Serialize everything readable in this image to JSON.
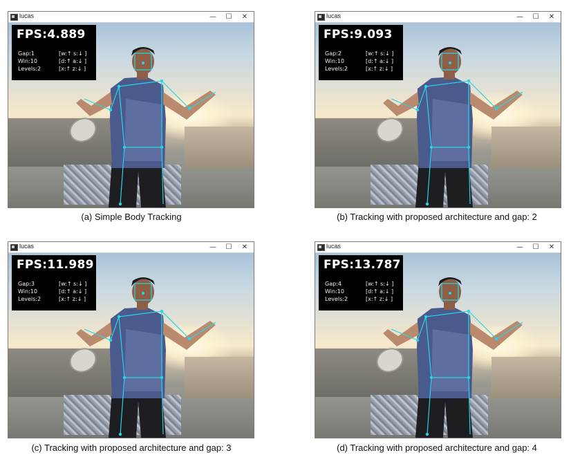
{
  "panels": [
    {
      "window_title": "lucas",
      "fps": "FPS:4.889",
      "gap": "Gap:1",
      "win": "Win:10",
      "levels": "Levels:2",
      "keys_gap": "[w:↑ s:↓ ]",
      "keys_win": "[d:↑ a:↓ ]",
      "keys_levels": "[x:↑ z:↓ ]",
      "caption": "(a) Simple Body Tracking"
    },
    {
      "window_title": "lucas",
      "fps": "FPS:9.093",
      "gap": "Gap:2",
      "win": "Win:10",
      "levels": "Levels:2",
      "keys_gap": "[w:↑ s:↓ ]",
      "keys_win": "[d:↑ a:↓ ]",
      "keys_levels": "[x:↑ z:↓ ]",
      "caption": "(b) Tracking with proposed architecture and gap: 2"
    },
    {
      "window_title": "lucas",
      "fps": "FPS:11.989",
      "gap": "Gap:3",
      "win": "Win:10",
      "levels": "Levels:2",
      "keys_gap": "[w:↑ s:↓ ]",
      "keys_win": "[d:↑ a:↓ ]",
      "keys_levels": "[x:↑ z:↓ ]",
      "caption": "(c) Tracking with proposed architecture and gap: 3"
    },
    {
      "window_title": "lucas",
      "fps": "FPS:13.787",
      "gap": "Gap:4",
      "win": "Win:10",
      "levels": "Levels:2",
      "keys_gap": "[w:↑ s:↓ ]",
      "keys_win": "[d:↑ a:↓ ]",
      "keys_levels": "[x:↑ z:↓ ]",
      "caption": "(d) Tracking with proposed architecture and gap: 4"
    }
  ],
  "window_controls": {
    "minimize": "—",
    "maximize": "☐",
    "close": "✕"
  },
  "colors": {
    "skeleton": "#29d4e6",
    "overlay_bg": "#000000",
    "titlebar": "#ffffff"
  }
}
